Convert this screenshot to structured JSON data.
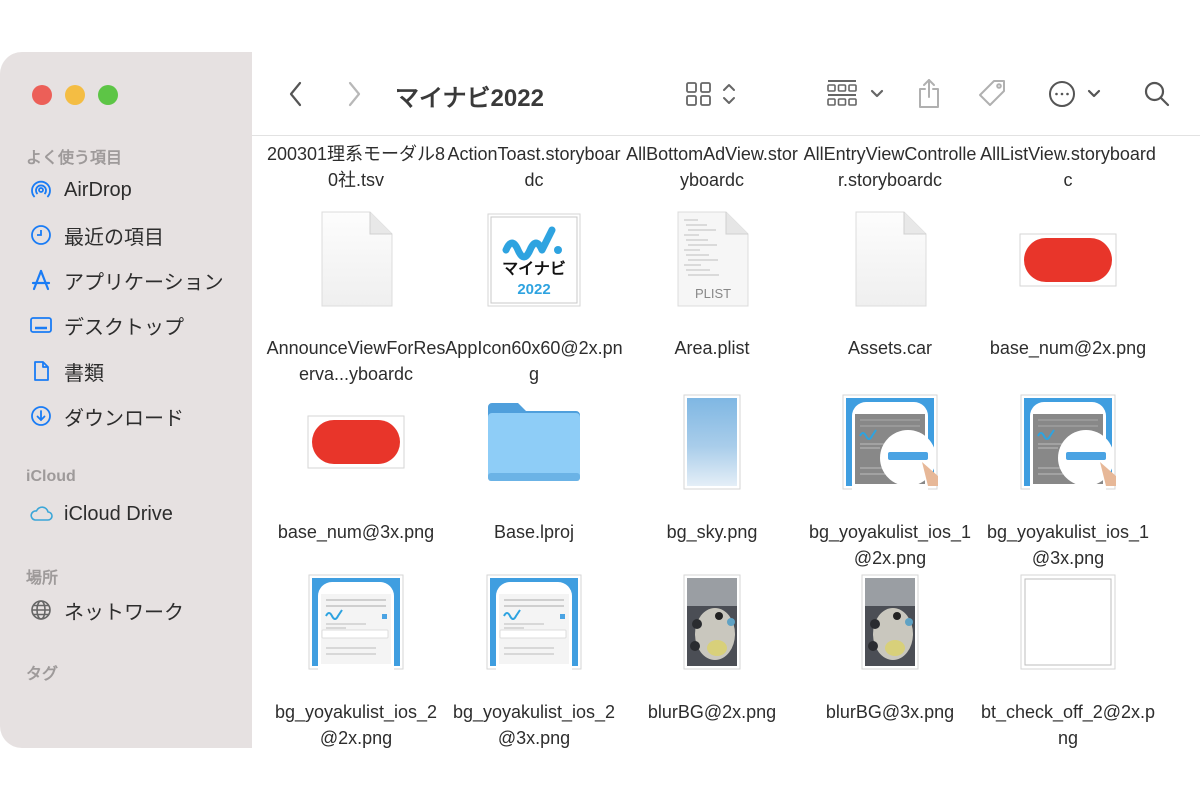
{
  "window": {
    "title": "マイナビ2022",
    "controls": [
      "close",
      "minimize",
      "maximize"
    ]
  },
  "sidebar": {
    "sections": [
      {
        "title": "よく使う項目",
        "items": [
          {
            "label": "AirDrop",
            "icon": "airdrop-icon"
          },
          {
            "label": "最近の項目",
            "icon": "clock-icon"
          },
          {
            "label": "アプリケーション",
            "icon": "applications-icon"
          },
          {
            "label": "デスクトップ",
            "icon": "desktop-icon"
          },
          {
            "label": "書類",
            "icon": "document-icon"
          },
          {
            "label": "ダウンロード",
            "icon": "download-icon"
          }
        ]
      },
      {
        "title": "iCloud",
        "items": [
          {
            "label": "iCloud Drive",
            "icon": "cloud-icon"
          }
        ]
      },
      {
        "title": "場所",
        "items": [
          {
            "label": "ネットワーク",
            "icon": "globe-icon"
          }
        ]
      },
      {
        "title": "タグ",
        "items": []
      }
    ]
  },
  "toolbar": {
    "back": "back-icon",
    "forward": "forward-icon",
    "view_mode": "icon-view-icon",
    "group": "group-icon",
    "share": "share-icon",
    "tag": "tag-icon",
    "more": "more-icon",
    "search": "search-icon"
  },
  "files": [
    {
      "name": "200301理系モーダル80社.tsv",
      "kind": "partial"
    },
    {
      "name": "ActionToast.storyboardc",
      "kind": "partial"
    },
    {
      "name": "AllBottomAdView.storyboardc",
      "kind": "partial"
    },
    {
      "name": "AllEntryViewController.storyboardc",
      "kind": "partial"
    },
    {
      "name": "AllListView.storyboardc",
      "kind": "partial"
    },
    {
      "name": "AnnounceViewForReserva...yboardc",
      "kind": "blank-doc"
    },
    {
      "name": "AppIcon60x60@2x.png",
      "kind": "appicon",
      "icon_text": "マイナビ",
      "icon_year": "2022"
    },
    {
      "name": "Area.plist",
      "kind": "plist",
      "badge": "PLIST"
    },
    {
      "name": "Assets.car",
      "kind": "blank-doc"
    },
    {
      "name": "base_num@2x.png",
      "kind": "red-pill"
    },
    {
      "name": "base_num@3x.png",
      "kind": "red-pill"
    },
    {
      "name": "Base.lproj",
      "kind": "folder"
    },
    {
      "name": "bg_sky.png",
      "kind": "sky"
    },
    {
      "name": "bg_yoyakulist_ios_1@2x.png",
      "kind": "phone1"
    },
    {
      "name": "bg_yoyakulist_ios_1@3x.png",
      "kind": "phone1"
    },
    {
      "name": "bg_yoyakulist_ios_2@2x.png",
      "kind": "phone2"
    },
    {
      "name": "bg_yoyakulist_ios_2@3x.png",
      "kind": "phone2"
    },
    {
      "name": "blurBG@2x.png",
      "kind": "photo"
    },
    {
      "name": "blurBG@3x.png",
      "kind": "photo"
    },
    {
      "name": "bt_check_off_2@2x.png",
      "kind": "white-square"
    }
  ],
  "colors": {
    "accent": "#1a7cf5",
    "sidebar_bg": "#e6e1e1",
    "red_pill": "#e8352a",
    "folder": "#8ecdf7"
  }
}
